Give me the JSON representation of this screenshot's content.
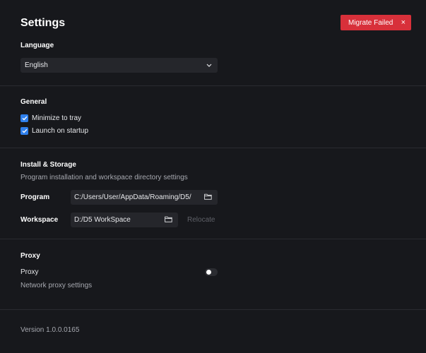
{
  "header": {
    "title": "Settings"
  },
  "toast": {
    "message": "Migrate Failed",
    "close_glyph": "×",
    "color": "#d8303a"
  },
  "language": {
    "title": "Language",
    "selected": "English",
    "options": [
      "English"
    ],
    "chevron_icon": "chevron-down-icon"
  },
  "general": {
    "title": "General",
    "options": [
      {
        "label": "Minimize to tray",
        "checked": true
      },
      {
        "label": "Launch on startup",
        "checked": true
      }
    ],
    "check_color": "#2f80ed"
  },
  "storage": {
    "title": "Install & Storage",
    "description": "Program installation and workspace directory settings",
    "program": {
      "label": "Program",
      "path": "C:/Users/User/AppData/Roaming/D5/",
      "icon": "folder-icon"
    },
    "workspace": {
      "label": "Workspace",
      "path": "D:/D5 WorkSpace",
      "icon": "folder-icon",
      "relocate_label": "Relocate",
      "relocate_enabled": false
    }
  },
  "proxy": {
    "title": "Proxy",
    "label": "Proxy",
    "description": "Network proxy settings",
    "enabled": false
  },
  "footer": {
    "version": "Version 1.0.0.0165"
  }
}
